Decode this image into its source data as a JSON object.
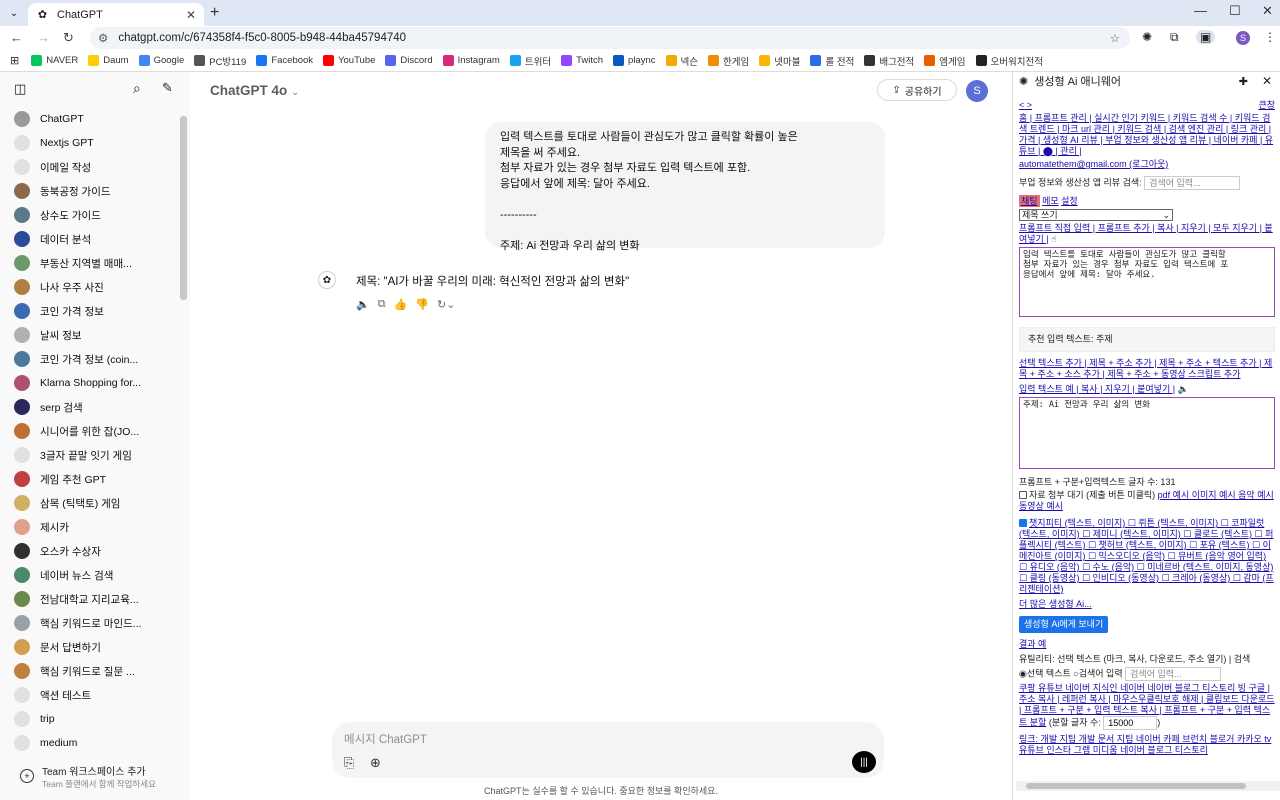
{
  "browser": {
    "tab_title": "ChatGPT",
    "tab_close": "✕",
    "new_tab": "+",
    "url": "chatgpt.com/c/674358f4-f5c0-8005-b948-44ba45794740",
    "bookmarks": [
      {
        "label": "NAVER",
        "color": "#03c75a"
      },
      {
        "label": "Daum",
        "color": "#ffcd00"
      },
      {
        "label": "Google",
        "color": "#4285f4"
      },
      {
        "label": "PC방119",
        "color": "#555555"
      },
      {
        "label": "Facebook",
        "color": "#1877f2"
      },
      {
        "label": "YouTube",
        "color": "#ff0000"
      },
      {
        "label": "Discord",
        "color": "#5865f2"
      },
      {
        "label": "Instagram",
        "color": "#d62976"
      },
      {
        "label": "트위터",
        "color": "#1da1f2"
      },
      {
        "label": "Twitch",
        "color": "#9146ff"
      },
      {
        "label": "plaync",
        "color": "#0a56c2"
      },
      {
        "label": "넥슨",
        "color": "#f2a900"
      },
      {
        "label": "한게임",
        "color": "#f28c00"
      },
      {
        "label": "넷마블",
        "color": "#ffb400"
      },
      {
        "label": "롤 전적",
        "color": "#2b6de6"
      },
      {
        "label": "배그전적",
        "color": "#333333"
      },
      {
        "label": "엠게임",
        "color": "#e85d00"
      },
      {
        "label": "오버워치전적",
        "color": "#222222"
      }
    ]
  },
  "sidebar": {
    "items": [
      {
        "label": "ChatGPT",
        "color": "#9a9a9a"
      },
      {
        "label": "Nextjs GPT",
        "color": "#e0e0e0"
      },
      {
        "label": "이메일 작성",
        "color": "#e0e0e0"
      },
      {
        "label": "동북공정 가이드",
        "color": "#8a6a4a"
      },
      {
        "label": "상수도 가이드",
        "color": "#5a7a8a"
      },
      {
        "label": "데이터 분석",
        "color": "#2a4a9a"
      },
      {
        "label": "부동산 지역별 매매...",
        "color": "#6a9a6a"
      },
      {
        "label": "나사 우주 사진",
        "color": "#b08040"
      },
      {
        "label": "코인 가격 정보",
        "color": "#3a6ab0"
      },
      {
        "label": "날씨 정보",
        "color": "#b0b0b0"
      },
      {
        "label": "코인 가격 정보 (coin...",
        "color": "#4a7a9a"
      },
      {
        "label": "Klarna Shopping for...",
        "color": "#b05070"
      },
      {
        "label": "serp 검색",
        "color": "#2a2a5a"
      },
      {
        "label": "시니어를 위한 잡(JO...",
        "color": "#c07030"
      },
      {
        "label": "3글자 끝말 잇기 게임",
        "color": "#e0e0e0"
      },
      {
        "label": "게임 추천 GPT",
        "color": "#c04040"
      },
      {
        "label": "삼목 (틱택토) 게임",
        "color": "#d0b060"
      },
      {
        "label": "제시카",
        "color": "#e0a090"
      },
      {
        "label": "오스카 수상자",
        "color": "#303030"
      },
      {
        "label": "네이버 뉴스 검색",
        "color": "#4a8a6a"
      },
      {
        "label": "전남대학교 지리교육...",
        "color": "#6a8a4a"
      },
      {
        "label": "핵심 키워드로 마인드...",
        "color": "#9aa0a8"
      },
      {
        "label": "문서 답변하기",
        "color": "#d0a050"
      },
      {
        "label": "핵심 키워드로 질문 ...",
        "color": "#c08040"
      },
      {
        "label": "액션 테스트",
        "color": "#e0e0e0"
      },
      {
        "label": "trip",
        "color": "#e0e0e0"
      },
      {
        "label": "medium",
        "color": "#e0e0e0"
      }
    ],
    "footer_title": "Team 워크스페이스 추가",
    "footer_sub": "Team 플랜에서 함께 작업하세요"
  },
  "chat": {
    "model": "ChatGPT 4o",
    "share": "공유하기",
    "avatar": "S",
    "user_lines": [
      "입력 텍스트를 토대로 사람들이 관심도가 많고 클릭할 확률이 높은",
      "제목을 써 주세요.",
      "첨부 자료가 있는 경우 첨부 자료도 입력 텍스트에 포함.",
      "응답에서 앞에 제목: 달아 주세요.",
      "",
      "----------",
      "",
      "주제: Ai 전망과 우리 삶의 변화"
    ],
    "response": "제목: \"AI가 바꿀 우리의 미래: 혁신적인 전망과 삶의 변화\"",
    "composer_placeholder": "메시지 ChatGPT",
    "disclaimer": "ChatGPT는 실수를 할 수 있습니다. 중요한 정보를 확인하세요."
  },
  "panel": {
    "title": "생성형 Ai 애니웨어",
    "nav_prev": "< >",
    "nav_right": "큰창",
    "links1": "홈 | 프롬프트 관리 | 실시간 인기 키워드 | 키워드 검색 수 | 키워드 검색 트렌드 | 마크 url 관리 | 키워드 검색 | 검색 엔진 관리 | 링크 관리 | 가격 | 생성형 AI 리뷰 | 부업 정보와 생산성 앱 리뷰 | 네이버 카페 | 유튜브 | ⬤ | 관리 |",
    "email": "automatethem@gmail.com (로그아웃)",
    "review_search_label": "부업 정보와 생산성 앱 리뷰 검색:",
    "search_placeholder": "검색어 입력...",
    "tab_chat": "채팅",
    "tab_memo": "메모",
    "tab_settings": "설정",
    "select_value": "제목 쓰기",
    "prompt_links": "프롬프트 직접 입력 | 프롬프트 추가 | 복사 | 지우기 | 모두 지우기 | 붙여넣기 |",
    "prompt_text": "입력 텍스트를 토대로 사람들이 관심도가 많고 클릭할\n첨부 자료가 있는 경우 첨부 자료도 입력 텍스트에 포\n응답에서 앞에 제목: 달아 주세요.",
    "recommended": "추천 입력 텍스트: 주제",
    "add_links": "선택 텍스트 추가 | 제목 + 주소 추가 | 제목 + 주소 + 텍스트 추가 | 제목 + 주소 + 소스 추가 | 제목 + 주소 + 동영상 스크립트 추가",
    "input_links": "입력 텍스트 예 | 복사 | 지우기 | 붙여넣기 |",
    "input_text": "주제: Ai 전망과 우리 삶의 변화",
    "char_count": "프롬프트 + 구분+입력텍스트 글자 수: 131",
    "attach_label": "자료 첨부 대기 (제출 버튼 미클릭)",
    "attach_links": "pdf 예시 이미지 예시 음악 예시 동영상 예시",
    "models_text": "챗지피티 (텍스트, 이미지) ☐ 뤼튼 (텍스트, 이미지) ☐ 코파일럿 (텍스트, 이미지) ☐ 제미니 (텍스트, 이미지) ☐ 클로드 (텍스트) ☐ 퍼플렉시티 (텍스트) ☐ 챗허브 (텍스트, 이미지) ☐ 포유 (텍스트) ☐ 이메진아트 (이미지) ☐ 믹스오디오 (음악) ☐ 뮤버트 (음악 영어 입력) ☐ 유디오 (음악) ☐ 수노 (음악) ☐ 미네르바 (텍스트, 이미지, 동영상) ☐ 클링 (동영상) ☐ 인비디오 (동영상) ☐ 크레아 (동영상) ☐ 감마 (프리젠테이션)",
    "more_link": "더 많은 생성형 Ai...",
    "send_button": "생성형 Ai에게 보내기",
    "result_link": "결과 예",
    "utility_text": "유틸리티: 선택 텍스트 (마크, 복사, 다운로드, 주소 열기) | 검색",
    "radio_selected": "선택 텍스트",
    "radio_other": "검색어 입력",
    "utility_links": "쿠팡 유튜브 네이버 지식인 네이버 네이버 블로그 티스토리 빙 구글 | 주소 복사 | 레퍼런 복사 | 마우스우클릭보호 해제 | 클립보드 다운로드 | 프롬프트 + 구분 + 입력 텍스트 복사 | 프롬프트 + 구분 + 입력 텍스트 분할",
    "split_label": "(분할 글자 수:",
    "split_value": "15000",
    "bottom_links": "링크: 개발 지팁 개발 문서 지팁 네이버 카페 브런치 블로거 카카오 tv 유튜브 인스타 그램 미디움 네이버 블로그 티스토리"
  }
}
